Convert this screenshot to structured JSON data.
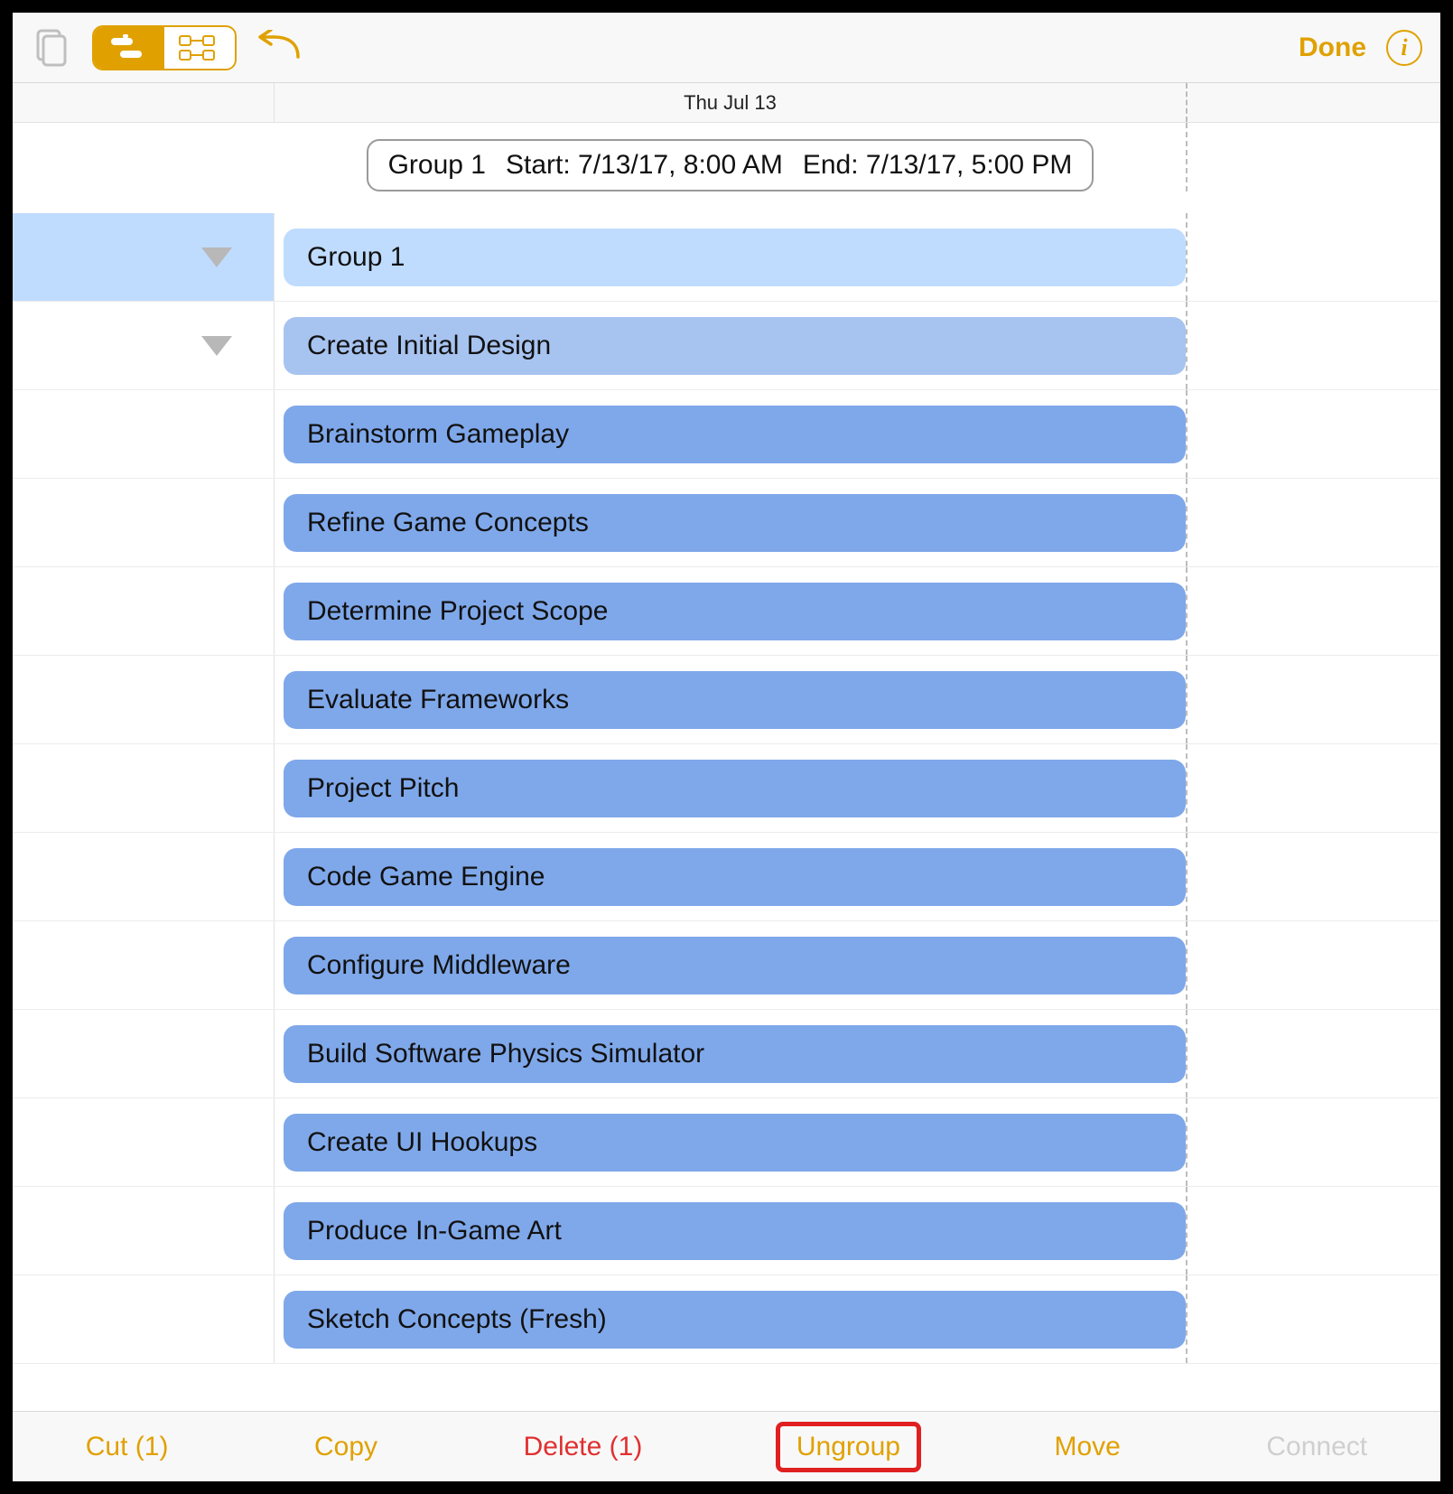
{
  "toolbar": {
    "done_label": "Done"
  },
  "date_header": "Thu Jul 13",
  "bubble": {
    "group": "Group 1",
    "start": "Start: 7/13/17, 8:00 AM",
    "end": "End: 7/13/17, 5:00 PM"
  },
  "tasks": [
    {
      "label": "Group 1",
      "style": "selected",
      "tri": true
    },
    {
      "label": "Create Initial Design",
      "style": "light",
      "tri": true
    },
    {
      "label": "Brainstorm Gameplay",
      "style": "dark",
      "tri": false
    },
    {
      "label": "Refine Game Concepts",
      "style": "dark",
      "tri": false
    },
    {
      "label": "Determine Project Scope",
      "style": "dark",
      "tri": false
    },
    {
      "label": "Evaluate Frameworks",
      "style": "dark",
      "tri": false
    },
    {
      "label": "Project Pitch",
      "style": "dark",
      "tri": false
    },
    {
      "label": "Code Game Engine",
      "style": "dark",
      "tri": false
    },
    {
      "label": "Configure Middleware",
      "style": "dark",
      "tri": false
    },
    {
      "label": "Build Software Physics Simulator",
      "style": "dark",
      "tri": false
    },
    {
      "label": "Create UI Hookups",
      "style": "dark",
      "tri": false
    },
    {
      "label": "Produce In-Game Art",
      "style": "dark",
      "tri": false
    },
    {
      "label": "Sketch Concepts (Fresh)",
      "style": "dark",
      "tri": false
    }
  ],
  "actions": {
    "cut": "Cut (1)",
    "copy": "Copy",
    "delete": "Delete (1)",
    "ungroup": "Ungroup",
    "move": "Move",
    "connect": "Connect"
  }
}
